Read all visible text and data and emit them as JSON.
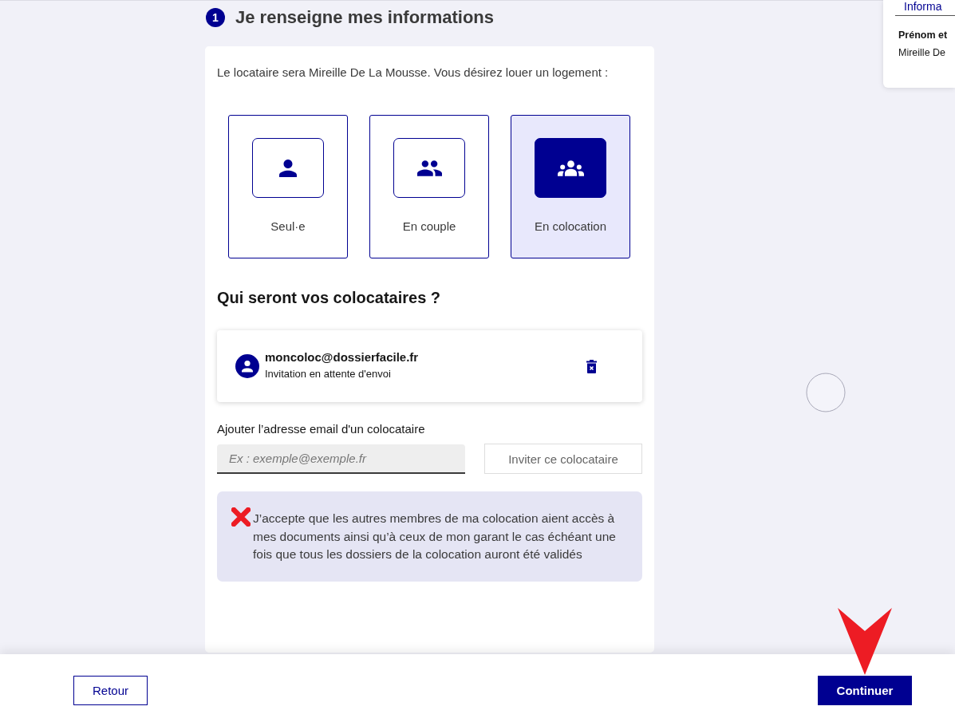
{
  "step": {
    "number": "1",
    "title": "Je renseigne mes informations"
  },
  "intro": "Le locataire sera Mireille De La Mousse. Vous désirez louer un logement :",
  "options": [
    {
      "label": "Seul·e",
      "kind": "single",
      "selected": false
    },
    {
      "label": "En couple",
      "kind": "couple",
      "selected": false
    },
    {
      "label": "En colocation",
      "kind": "group",
      "selected": true
    }
  ],
  "roommates_heading": "Qui seront vos colocataires ?",
  "roommates": [
    {
      "email": "moncoloc@dossierfacile.fr",
      "status": "Invitation en attente d'envoi"
    }
  ],
  "invite": {
    "label": "Ajouter l’adresse email d'un colocataire",
    "placeholder": "Ex : exemple@exemple.fr",
    "button": "Inviter ce colocataire"
  },
  "consent": {
    "text": "J’accepte que les autres membres de ma colocation aient accès à mes documents ainsi qu’à ceux de mon garant le cas échéant une fois que tous les dossiers de la colocation auront été validés"
  },
  "side_panel": {
    "title": "Informa",
    "field_label": "Prénom et",
    "field_value": "Mireille De"
  },
  "footer": {
    "back": "Retour",
    "next": "Continuer"
  }
}
